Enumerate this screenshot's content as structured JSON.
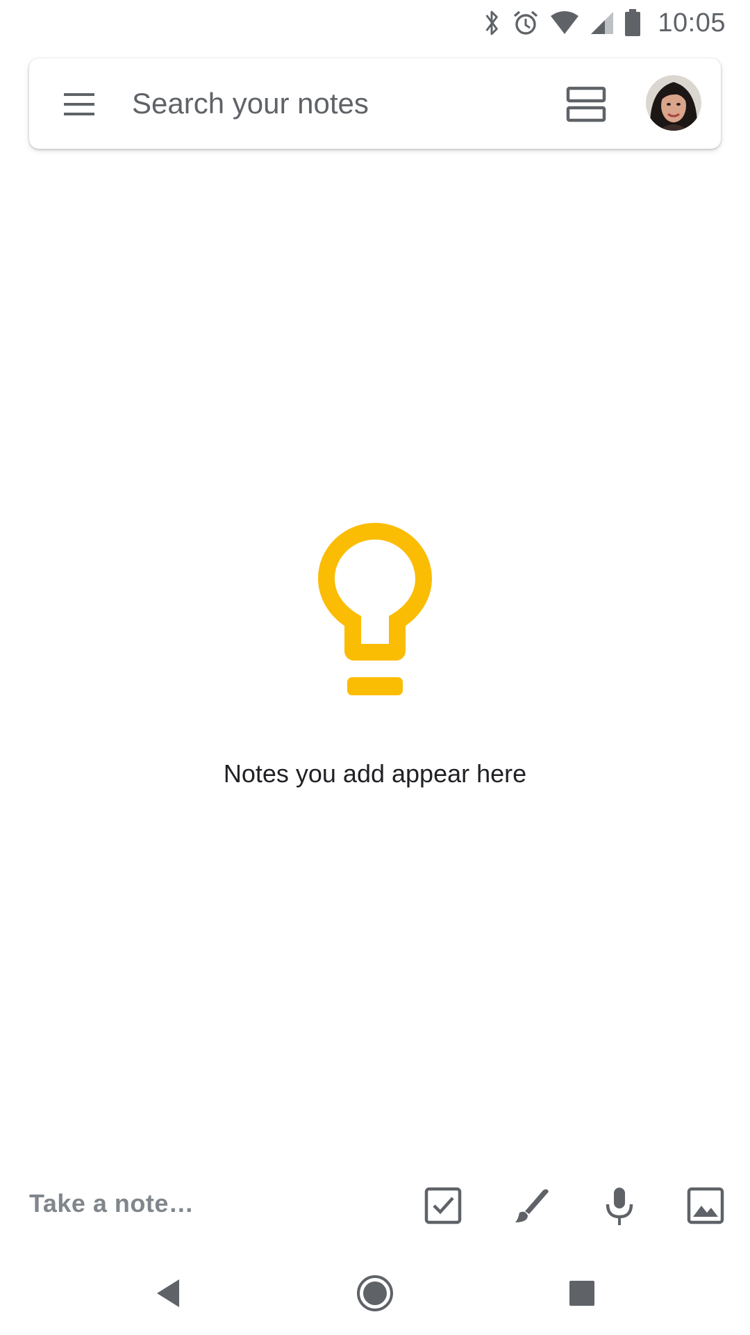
{
  "status_bar": {
    "time": "10:05",
    "icons": [
      "bluetooth-icon",
      "alarm-icon",
      "wifi-icon",
      "cell-signal-icon",
      "battery-icon"
    ]
  },
  "search_bar": {
    "placeholder": "Search your notes",
    "menu_icon": "menu-icon",
    "layout_icon": "grid-view-icon",
    "avatar_icon": "account-avatar"
  },
  "empty_state": {
    "icon": "lightbulb-icon",
    "message": "Notes you add appear here",
    "accent_color": "#FBBC04"
  },
  "note_bar": {
    "placeholder": "Take a note…",
    "tools": [
      "new-list-icon",
      "new-drawing-icon",
      "new-audio-note-icon",
      "new-image-note-icon"
    ]
  },
  "nav_bar": {
    "buttons": [
      "back-icon",
      "home-icon",
      "recents-icon"
    ]
  }
}
